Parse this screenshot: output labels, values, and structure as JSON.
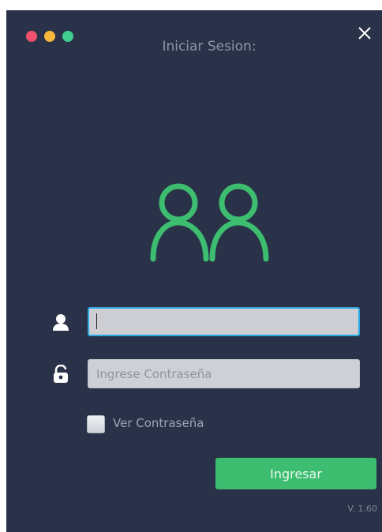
{
  "window": {
    "title": "Iniciar Sesion:",
    "traffic_lights": [
      {
        "name": "red",
        "color": "#f0506e"
      },
      {
        "name": "yellow",
        "color": "#f5b83b"
      },
      {
        "name": "green",
        "color": "#3ecf8e"
      }
    ],
    "close_icon": "close-icon"
  },
  "form": {
    "username": {
      "icon": "user-icon",
      "value": "",
      "placeholder": ""
    },
    "password": {
      "icon": "unlocked-padlock-icon",
      "value": "",
      "placeholder": "Ingrese Contraseña"
    },
    "show_password": {
      "label": "Ver Contraseña",
      "checked": false
    },
    "submit_label": "Ingresar"
  },
  "footer": {
    "version": "V. 1.60"
  },
  "colors": {
    "background": "#293248",
    "accent_green": "#3dbd70",
    "focus_blue": "#2ba7e3",
    "icon_white": "#ffffff"
  }
}
